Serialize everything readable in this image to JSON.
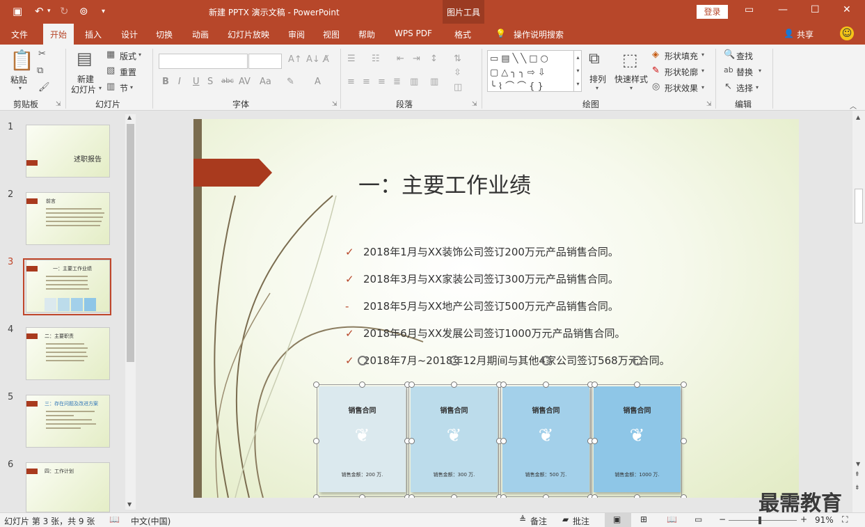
{
  "window": {
    "title": "新建 PPTX 演示文稿 - PowerPoint",
    "tool_context": "图片工具",
    "login": "登录"
  },
  "tabs": [
    "文件",
    "开始",
    "插入",
    "设计",
    "切换",
    "动画",
    "幻灯片放映",
    "审阅",
    "视图",
    "帮助",
    "WPS PDF",
    "格式"
  ],
  "tell_me": "操作说明搜索",
  "share": "共享",
  "ribbon": {
    "clipboard": {
      "label": "剪贴板",
      "paste": "粘贴"
    },
    "slides": {
      "label": "幻灯片",
      "new_slide": "新建",
      "new_slide2": "幻灯片",
      "layout": "版式",
      "reset": "重置",
      "section": "节"
    },
    "font": {
      "label": "字体"
    },
    "paragraph": {
      "label": "段落"
    },
    "drawing": {
      "label": "绘图",
      "arrange": "排列",
      "quick_styles": "快速样式",
      "fill": "形状填充",
      "outline": "形状轮廓",
      "effects": "形状效果"
    },
    "editing": {
      "label": "编辑",
      "find": "查找",
      "replace": "替换",
      "select": "选择"
    }
  },
  "thumbnails": [
    {
      "num": "1",
      "title": "述职报告"
    },
    {
      "num": "2",
      "title": "前言"
    },
    {
      "num": "3",
      "title": "一：主要工作业绩"
    },
    {
      "num": "4",
      "title": "二：主要职责"
    },
    {
      "num": "5",
      "title": "三：存在问题及改进方案"
    },
    {
      "num": "6",
      "title": "四：工作计划"
    }
  ],
  "slide": {
    "title": "一：主要工作业绩",
    "bullets": [
      {
        "mark": "✓",
        "text": "2018年1月与XX装饰公司签订200万元产品销售合同。"
      },
      {
        "mark": "✓",
        "text": "2018年3月与XX家装公司签订300万元产品销售合同。"
      },
      {
        "mark": "-",
        "text": "2018年5月与XX地产公司签订500万元产品销售合同。"
      },
      {
        "mark": "✓",
        "text": "2018年6月与XX发展公司签订1000万元产品销售合同。"
      },
      {
        "mark": "✓",
        "text": "2018年7月~2018年12月期间与其他4家公司签订568万元合同。"
      }
    ],
    "cards": [
      {
        "heading": "销售合同",
        "amount": "销售金额：200 万.",
        "color": "#dbe9ee"
      },
      {
        "heading": "销售合同",
        "amount": "销售金额：300 万.",
        "color": "#bcdceb"
      },
      {
        "heading": "销售合同",
        "amount": "销售金额：500 万.",
        "color": "#a3d0ea"
      },
      {
        "heading": "销售合同",
        "amount": "销售金额：1000 万.",
        "color": "#8ec6e7"
      }
    ]
  },
  "status": {
    "slide_info": "幻灯片 第 3 张，共 9 张",
    "language": "中文(中国)",
    "notes": "备注",
    "comments": "批注",
    "zoom": "91%"
  },
  "watermark": "最需教育"
}
